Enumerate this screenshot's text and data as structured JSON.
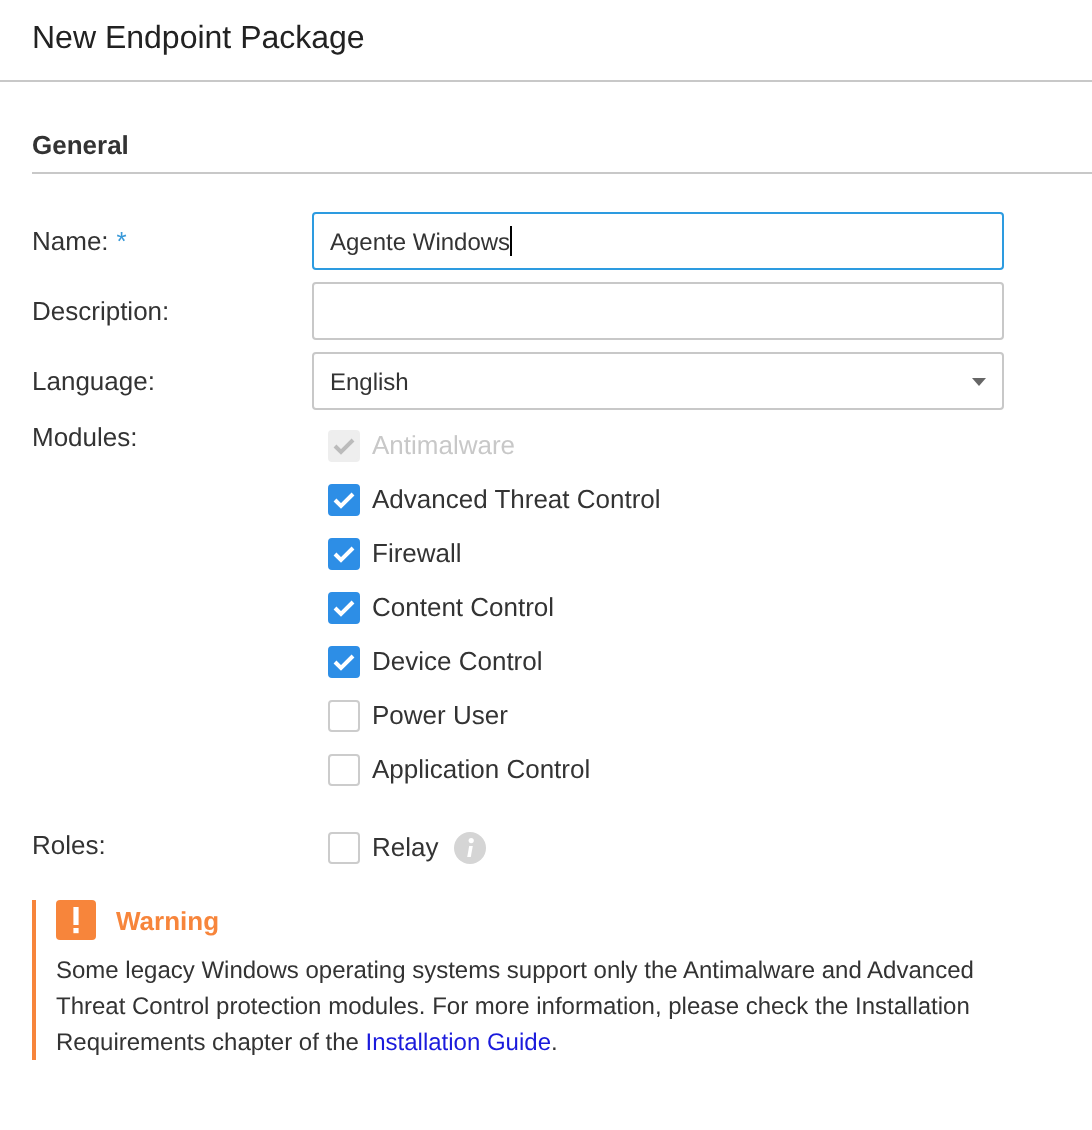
{
  "window": {
    "title": "New Endpoint Package"
  },
  "section": {
    "title": "General"
  },
  "fields": [
    {
      "label": "Name:",
      "required_mark": "*",
      "kind": "text",
      "value": "Agente Windows",
      "focused": true
    },
    {
      "label": "Description:",
      "kind": "text",
      "focused": false
    },
    {
      "label": "Language:",
      "kind": "select",
      "value": "English",
      "focused": false
    }
  ],
  "modules": {
    "label": "Modules:",
    "items": [
      {
        "label": "Antimalware",
        "checked": true,
        "disabled": true
      },
      {
        "label": "Advanced Threat Control",
        "checked": true,
        "disabled": false
      },
      {
        "label": "Firewall",
        "checked": true,
        "disabled": false
      },
      {
        "label": "Content Control",
        "checked": true,
        "disabled": false
      },
      {
        "label": "Device Control",
        "checked": true,
        "disabled": false
      },
      {
        "label": "Power User",
        "checked": false,
        "disabled": false
      },
      {
        "label": "Application Control",
        "checked": false,
        "disabled": false
      }
    ]
  },
  "roles": {
    "label": "Roles:",
    "items": [
      {
        "label": "Relay",
        "checked": false,
        "disabled": false
      }
    ]
  },
  "warning": {
    "title": "Warning",
    "text": "Some legacy Windows operating systems support only the Antimalware and Advanced Threat Control protection modules. For more information, please check the Installation Requirements chapter of the ",
    "link": "Installation Guide",
    "text_end": "."
  }
}
